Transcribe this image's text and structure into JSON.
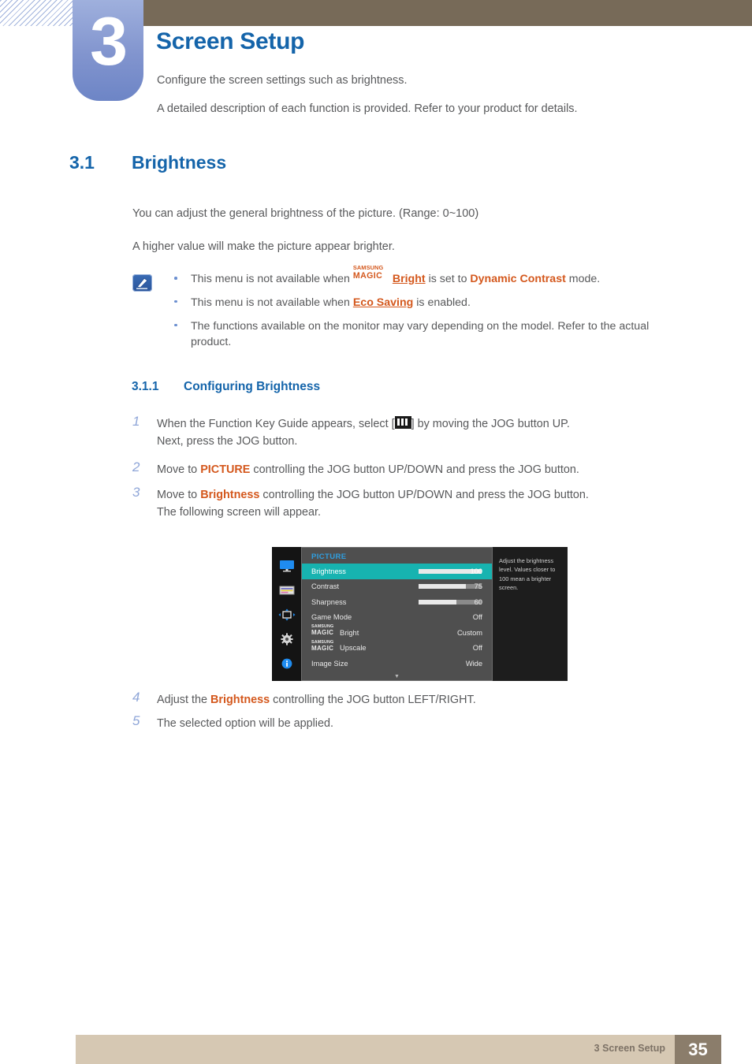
{
  "chapter": {
    "number": "3",
    "title": "Screen Setup",
    "intro_line1": "Configure the screen settings such as brightness.",
    "intro_line2": "A detailed description of each function is provided. Refer to your product for details."
  },
  "section": {
    "number": "3.1",
    "title": "Brightness",
    "paragraph1": "You can adjust the general brightness of the picture. (Range: 0~100)",
    "paragraph2": "A higher value will make the picture appear brighter."
  },
  "note": {
    "icon": "note-pen-icon",
    "bullets": [
      {
        "pre": "This menu is not available when ",
        "magic_top": "SAMSUNG",
        "magic_bottom": "MAGIC",
        "link": "Bright",
        "mid": " is set to ",
        "highlight": "Dynamic Contrast",
        "post": " mode."
      },
      {
        "pre": "This menu is not available when ",
        "link": "Eco Saving",
        "post": " is enabled."
      },
      {
        "pre": "The functions available on the monitor may vary depending on the model. Refer to the actual product."
      }
    ]
  },
  "subsection": {
    "number": "3.1.1",
    "title": "Configuring Brightness"
  },
  "steps": [
    {
      "number": "1",
      "pre": "When the Function Key Guide appears, select [",
      "icon": "menu-bars-icon",
      "post": "] by moving the JOG button UP.",
      "line2": "Next, press the JOG button."
    },
    {
      "number": "2",
      "pre": "Move to ",
      "highlight": "PICTURE",
      "post": " controlling the JOG button UP/DOWN and press the JOG button."
    },
    {
      "number": "3",
      "pre": "Move to ",
      "highlight": "Brightness",
      "post": " controlling the JOG button UP/DOWN and press the JOG button.",
      "line2": "The following screen will appear."
    },
    {
      "number": "4",
      "pre": "Adjust the ",
      "highlight": "Brightness",
      "post": " controlling the JOG button LEFT/RIGHT."
    },
    {
      "number": "5",
      "pre": "The selected option will be applied."
    }
  ],
  "osd": {
    "title": "PICTURE",
    "rail_icons": [
      "monitor-icon",
      "picture-color-icon",
      "screen-adjust-icon",
      "gear-icon",
      "info-icon"
    ],
    "rows": [
      {
        "label": "Brightness",
        "value": "100",
        "bar": 100,
        "selected": true
      },
      {
        "label": "Contrast",
        "value": "75",
        "bar": 75,
        "selected": false
      },
      {
        "label": "Sharpness",
        "value": "60",
        "bar": 60,
        "selected": false
      },
      {
        "label": "Game Mode",
        "value": "Off",
        "selected": false
      },
      {
        "magic_top": "SAMSUNG",
        "magic_bottom": "MAGIC",
        "label": "Bright",
        "value": "Custom",
        "selected": false
      },
      {
        "magic_top": "SAMSUNG",
        "magic_bottom": "MAGIC",
        "label": "Upscale",
        "value": "Off",
        "selected": false
      },
      {
        "label": "Image Size",
        "value": "Wide",
        "selected": false
      }
    ],
    "scroll_arrow": "▼",
    "tooltip": "Adjust the brightness level. Values closer to 100 mean a brighter screen."
  },
  "footer": {
    "text": "3 Screen Setup",
    "page": "35"
  },
  "colors": {
    "heading_blue": "#1464aa",
    "accent_orange": "#d4581b",
    "osd_teal": "#17b3b0",
    "band_brown": "#776a58",
    "footer_tan": "#d6c8b3"
  }
}
